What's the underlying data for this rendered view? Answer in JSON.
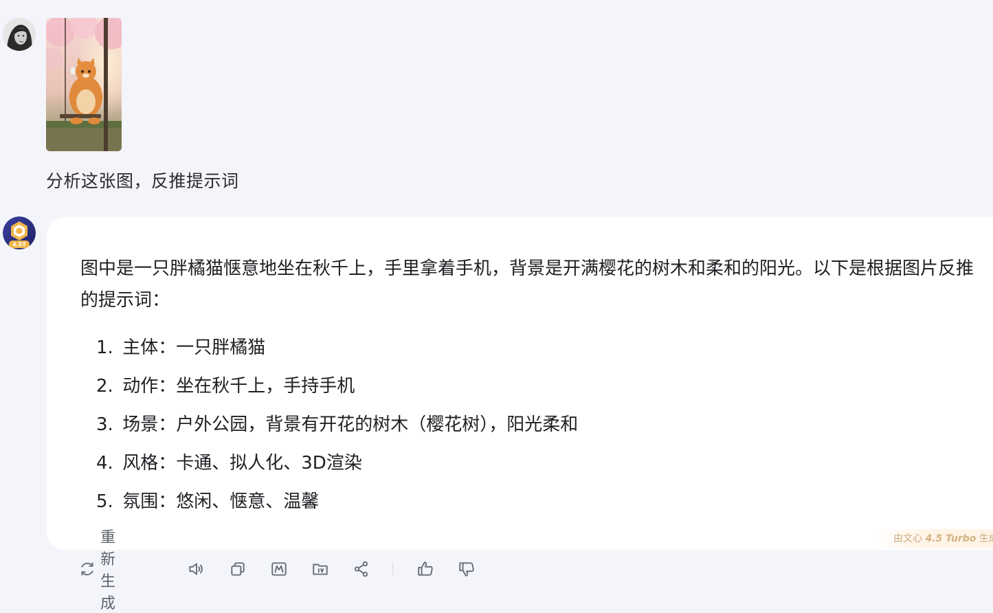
{
  "user": {
    "message": "分析这张图，反推提示词"
  },
  "assistant": {
    "avatar_badge": "4.5T",
    "intro": "图中是一只胖橘猫惬意地坐在秋千上，手里拿着手机，背景是开满樱花的树木和柔和的阳光。以下是根据图片反推的提示词：",
    "items": [
      {
        "num": "1.",
        "text": "主体：一只胖橘猫"
      },
      {
        "num": "2.",
        "text": "动作：坐在秋千上，手持手机"
      },
      {
        "num": "3.",
        "text": "场景：户外公园，背景有开花的树木（樱花树），阳光柔和"
      },
      {
        "num": "4.",
        "text": "风格：卡通、拟人化、3D渲染"
      },
      {
        "num": "5.",
        "text": "氛围：悠闲、惬意、温馨"
      }
    ],
    "watermark_prefix": "由文心",
    "watermark_brand": "4.5 Turbo",
    "watermark_suffix": "生成"
  },
  "toolbar": {
    "regenerate_label": "重新生成",
    "icons": [
      "refresh-icon",
      "speaker-icon",
      "copy-icon",
      "image-icon",
      "export-icon",
      "share-icon",
      "thumbs-up-icon",
      "thumbs-down-icon"
    ]
  },
  "colors": {
    "page_background": "#f4f5fb",
    "card_background": "#ffffff",
    "text": "#1f1f24",
    "toolbar_icon": "#6b6e79"
  }
}
